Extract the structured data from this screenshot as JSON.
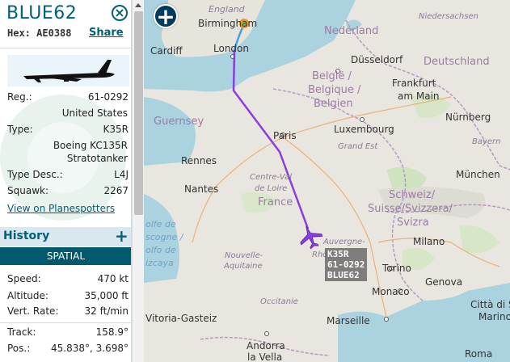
{
  "aircraft": {
    "callsign": "BLUE62",
    "hex_label": "Hex:",
    "hex_value": "AE0388",
    "share_label": "Share"
  },
  "details": {
    "reg_label": "Reg.:",
    "reg_value": "61-0292",
    "country": "United States",
    "type_label": "Type:",
    "type_value": "K35R",
    "model_line1": "Boeing KC135R",
    "model_line2": "Stratotanker",
    "typedesc_label": "Type Desc.:",
    "typedesc_value": "L4J",
    "squawk_label": "Squawk:",
    "squawk_value": "2267",
    "planespotters_link": "View on Planespotters"
  },
  "history": {
    "title": "History",
    "add_label": "+",
    "tab_label": "SPATIAL"
  },
  "spatial": {
    "speed_label": "Speed:",
    "speed_value": "470 kt",
    "altitude_label": "Altitude:",
    "altitude_value": "35,000 ft",
    "vrate_label": "Vert. Rate:",
    "vrate_value": "32 ft/min",
    "track_label": "Track:",
    "track_value": "158.9°",
    "pos_label": "Pos.:",
    "pos_value": "45.838°, 3.698°"
  },
  "map": {
    "zoom_label": "+",
    "aircraft_tag": [
      "K35R",
      "61-0292",
      "BLUE62"
    ],
    "route_color": "#8a3ee0",
    "route_start_color": "#3fa0e8",
    "aircraft_color": "#8a3ee0",
    "labels": {
      "england": "England",
      "birmingham": "Birmingham",
      "cardiff": "Cardiff",
      "london": "London",
      "nederland": "Nederland",
      "niedersachsen": "Niedersachsen",
      "dusseldorf": "Düsseldorf",
      "deutschland": "Deutschland",
      "belgie": "België /",
      "belgique": "Belgique /",
      "belgien": "Belgien",
      "frankfurt1": "Frankfurt",
      "frankfurt2": "am Main",
      "guernsey": "Guernsey",
      "paris": "Paris",
      "luxembourg": "Luxembourg",
      "nurnberg": "Nürnberg",
      "grand_est": "Grand Est",
      "bayern": "Bayern",
      "rennes": "Rennes",
      "centre1": "Centre-Val",
      "centre2": "de Loire",
      "munchen": "München",
      "nantes": "Nantes",
      "france": "France",
      "schweiz1": "Schweiz/",
      "schweiz2": "Suisse/Svizzera/",
      "schweiz3": "Svizra",
      "golfe1": "olfe de",
      "golfe2": "scogne /",
      "golfe3": "olfo de",
      "golfe4": "izcaya",
      "auvergne": "Auvergne-",
      "rhone": "Rhô",
      "milano": "Milano",
      "nouvelle1": "Nouvelle-",
      "nouvelle2": "Aquitaine",
      "torino": "Torino",
      "genova": "Genova",
      "monaco": "Monaco",
      "occitanie": "Occitanie",
      "citta1": "Città di S",
      "citta2": "Marino",
      "vitoria": "Vitoria-Gasteiz",
      "marseille": "Marseille",
      "andorra1": "Andorra",
      "andorra2": "la Vella",
      "roma": "Roma"
    }
  }
}
